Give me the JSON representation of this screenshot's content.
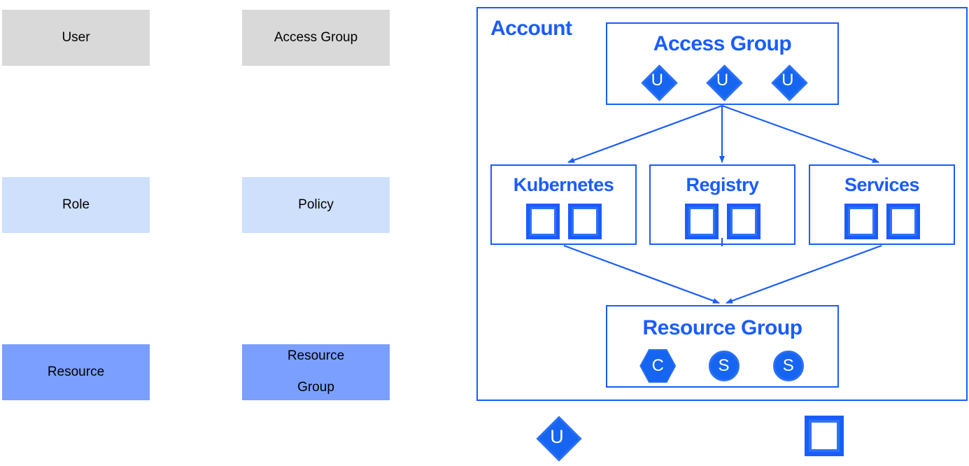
{
  "legend": {
    "items": [
      {
        "key": "user",
        "label": "User",
        "color": "#d9d9d9"
      },
      {
        "key": "access_group",
        "label": "Access Group",
        "color": "#d9d9d9"
      },
      {
        "key": "role",
        "label": "Role",
        "color": "#cfe0fc"
      },
      {
        "key": "policy",
        "label": "Policy",
        "color": "#cfe0fc"
      },
      {
        "key": "resource",
        "label": "Resource",
        "color": "#7b9fff"
      },
      {
        "key": "resource_group",
        "label_line1": "Resource",
        "label_line2": "Group",
        "color": "#7b9fff"
      }
    ]
  },
  "diagram": {
    "accent_color": "#1a5cff",
    "icon_fill": "#1565f0",
    "icon_border": "#2a6ff5",
    "icon_glyph_color": "#ffffff",
    "account": {
      "title": "Account"
    },
    "access_group": {
      "title": "Access Group",
      "members": [
        {
          "icon": "user-diamond-icon",
          "glyph": "U"
        },
        {
          "icon": "user-diamond-icon",
          "glyph": "U"
        },
        {
          "icon": "user-diamond-icon",
          "glyph": "U"
        }
      ]
    },
    "services": [
      {
        "key": "kubernetes",
        "title": "Kubernetes",
        "resources": [
          {
            "icon": "resource-square-icon"
          },
          {
            "icon": "resource-square-icon"
          }
        ]
      },
      {
        "key": "registry",
        "title": "Registry",
        "resources": [
          {
            "icon": "resource-square-icon"
          },
          {
            "icon": "resource-square-icon"
          }
        ]
      },
      {
        "key": "services",
        "title": "Services",
        "resources": [
          {
            "icon": "resource-square-icon"
          },
          {
            "icon": "resource-square-icon"
          }
        ]
      }
    ],
    "resource_group": {
      "title": "Resource Group",
      "members": [
        {
          "icon": "cluster-hexagon-icon",
          "glyph": "C"
        },
        {
          "icon": "service-circle-icon",
          "glyph": "S"
        },
        {
          "icon": "service-circle-icon",
          "glyph": "S"
        }
      ]
    },
    "bottom_legend": [
      {
        "key": "user_marker",
        "icon": "user-diamond-icon",
        "glyph": "U"
      },
      {
        "key": "resource_marker",
        "icon": "resource-square-icon",
        "glyph": ""
      }
    ]
  }
}
